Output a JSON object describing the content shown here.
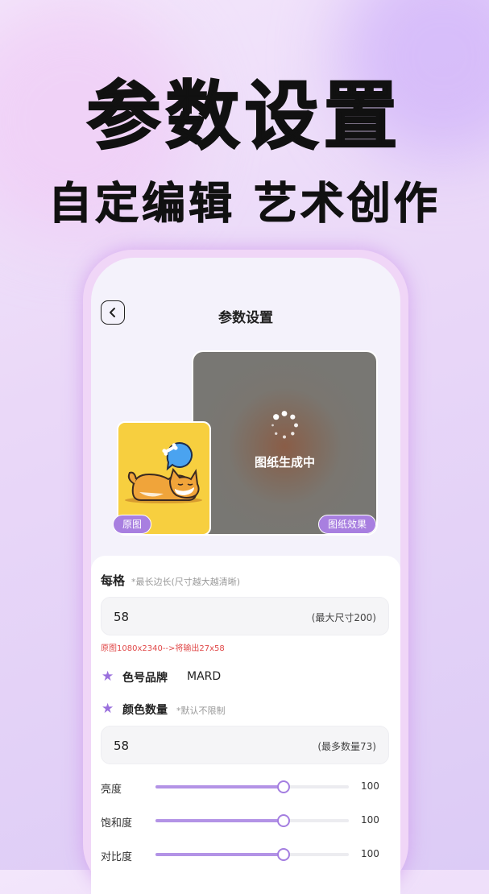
{
  "headline": {
    "title": "参数设置",
    "subtitle": "自定编辑 艺术创作"
  },
  "screen": {
    "nav_title": "参数设置",
    "back_icon": "chevron-left-icon",
    "preview": {
      "original_tag": "原图",
      "result_tag": "图纸效果",
      "generating_text": "图纸生成中"
    },
    "settings": {
      "grid_label": "每格",
      "grid_hint": "*最长边长(尺寸越大越清晰)",
      "grid_value": "58",
      "grid_max": "(最大尺寸200)",
      "resize_note": "原图1080x2340-->将输出27x58",
      "brand_label": "色号品牌",
      "brand_value": "MARD",
      "color_count_label": "颜色数量",
      "color_count_hint": "*默认不限制",
      "color_count_value": "58",
      "color_count_max": "(最多数量73)",
      "sliders": [
        {
          "label": "亮度",
          "value": "100",
          "fraction": 0.66
        },
        {
          "label": "饱和度",
          "value": "100",
          "fraction": 0.66
        },
        {
          "label": "对比度",
          "value": "100",
          "fraction": 0.66
        }
      ]
    }
  },
  "colors": {
    "accent": "#a87fe0",
    "warning": "#e04848",
    "original_bg": "#f7cf3f"
  }
}
